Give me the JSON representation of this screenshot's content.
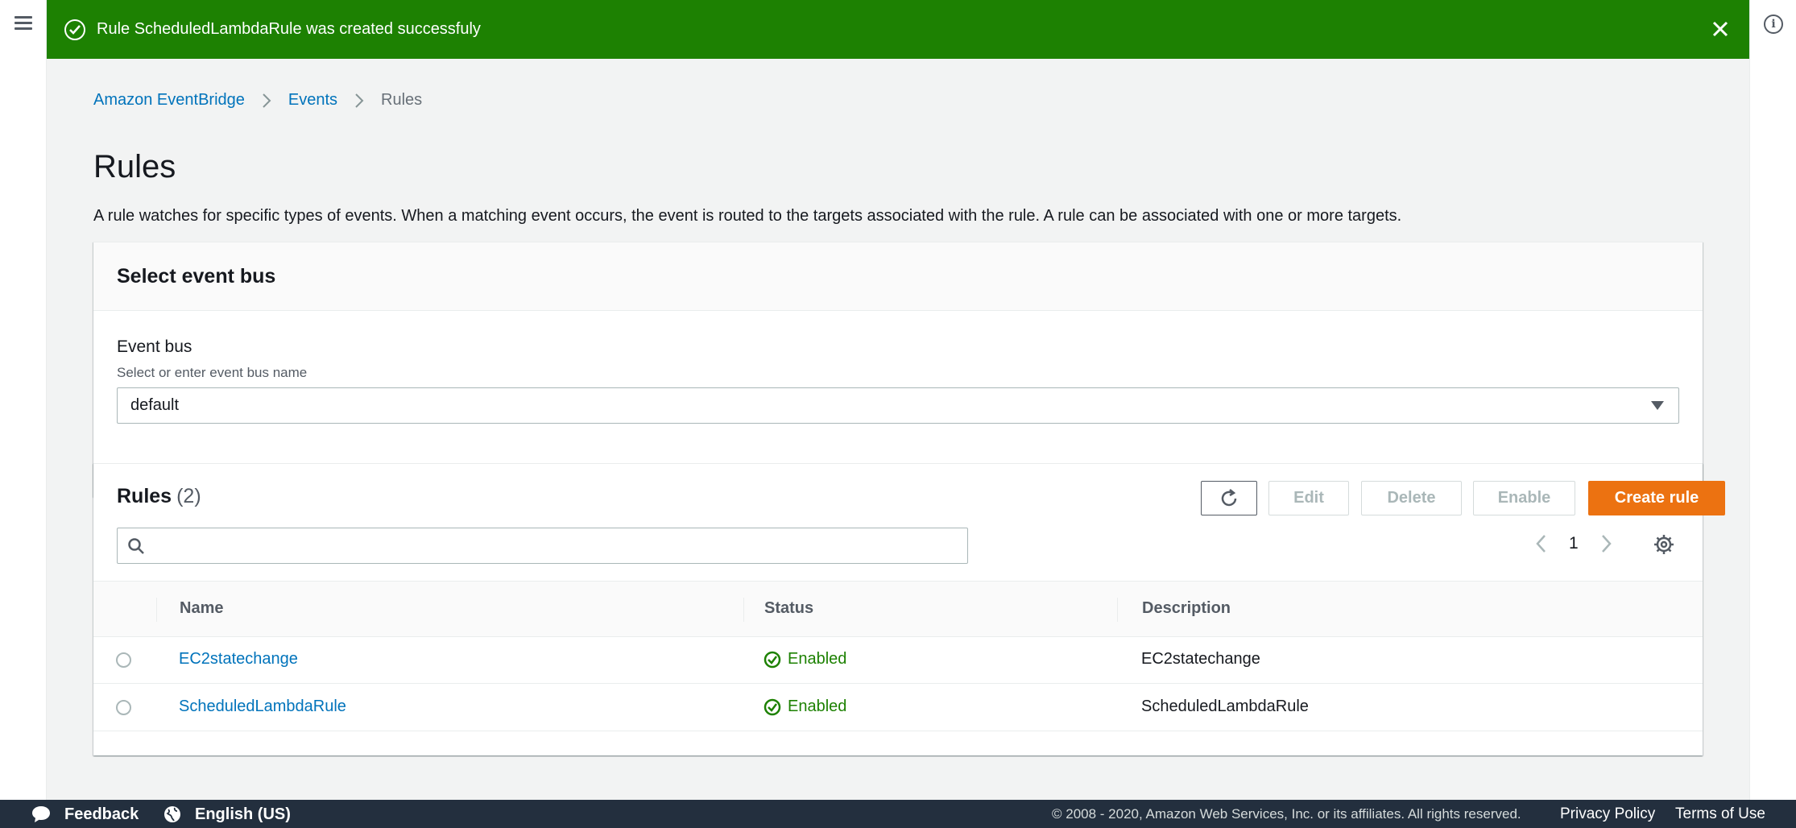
{
  "flash": {
    "message": "Rule ScheduledLambdaRule was created successfuly"
  },
  "breadcrumb": {
    "items": [
      "Amazon EventBridge",
      "Events"
    ],
    "current": "Rules"
  },
  "page": {
    "title": "Rules",
    "description": "A rule watches for specific types of events. When a matching event occurs, the event is routed to the targets associated with the rule. A rule can be associated with one or more targets."
  },
  "event_bus_panel": {
    "header": "Select event bus",
    "label": "Event bus",
    "description": "Select or enter event bus name",
    "value": "default"
  },
  "rules_panel": {
    "title": "Rules",
    "count": "(2)",
    "buttons": {
      "edit": "Edit",
      "delete": "Delete",
      "enable": "Enable",
      "create": "Create rule"
    },
    "search": {
      "value": ""
    },
    "page_number": "1",
    "columns": [
      "Name",
      "Status",
      "Description"
    ],
    "rows": [
      {
        "name": "EC2statechange",
        "status": "Enabled",
        "description": "EC2statechange"
      },
      {
        "name": "ScheduledLambdaRule",
        "status": "Enabled",
        "description": "ScheduledLambdaRule"
      }
    ]
  },
  "footer": {
    "feedback": "Feedback",
    "language": "English (US)",
    "copyright": "© 2008 - 2020, Amazon Web Services, Inc. or its affiliates. All rights reserved.",
    "privacy": "Privacy Policy",
    "terms": "Terms of Use"
  },
  "colors": {
    "success": "#1d8102",
    "primary_button": "#ec7211",
    "link": "#0073bb",
    "footer_bg": "#232f3e"
  }
}
